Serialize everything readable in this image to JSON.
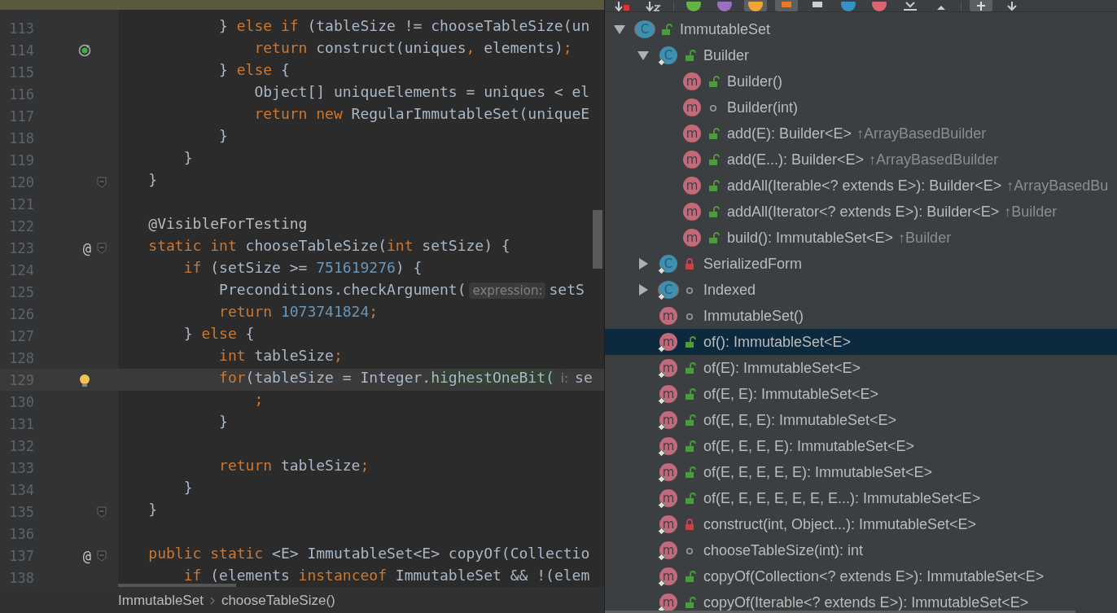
{
  "editor": {
    "lines": [
      {
        "number": "113",
        "fold": false,
        "current": false,
        "tokens": [
          {
            "kind": "plain",
            "text": "            } "
          },
          {
            "kind": "keyword",
            "text": "else if"
          },
          {
            "kind": "plain",
            "text": " (tableSize != chooseTableSize(un"
          }
        ]
      },
      {
        "number": "114",
        "gutter_icon": {
          "kind": "recursion"
        },
        "fold": false,
        "current": false,
        "tokens": [
          {
            "kind": "keyword",
            "text": "                return"
          },
          {
            "kind": "plain",
            "text": " construct(uniques"
          },
          {
            "kind": "keyword",
            "text": ","
          },
          {
            "kind": "plain",
            "text": " elements)"
          },
          {
            "kind": "keyword",
            "text": ";"
          }
        ]
      },
      {
        "number": "115",
        "fold": false,
        "current": false,
        "tokens": [
          {
            "kind": "plain",
            "text": "            } "
          },
          {
            "kind": "keyword",
            "text": "else"
          },
          {
            "kind": "plain",
            "text": " {"
          }
        ]
      },
      {
        "number": "116",
        "fold": false,
        "current": false,
        "tokens": [
          {
            "kind": "plain",
            "text": "                Object[] uniqueElements = uniques < el"
          }
        ]
      },
      {
        "number": "117",
        "fold": false,
        "current": false,
        "tokens": [
          {
            "kind": "keyword",
            "text": "                return new"
          },
          {
            "kind": "plain",
            "text": " RegularImmutableSet(uniqueE"
          }
        ]
      },
      {
        "number": "118",
        "fold": false,
        "current": false,
        "tokens": [
          {
            "kind": "plain",
            "text": "            }"
          }
        ]
      },
      {
        "number": "119",
        "fold": false,
        "current": false,
        "tokens": [
          {
            "kind": "plain",
            "text": "        }"
          }
        ]
      },
      {
        "number": "120",
        "fold": true,
        "current": false,
        "tokens": [
          {
            "kind": "plain",
            "text": "    }"
          }
        ]
      },
      {
        "number": "121",
        "fold": false,
        "current": false
      },
      {
        "number": "122",
        "fold": false,
        "current": false,
        "tokens": [
          {
            "kind": "annotation",
            "text": "    @VisibleForTesting"
          }
        ]
      },
      {
        "number": "123",
        "gutter_mark": "@",
        "fold": true,
        "current": false,
        "tokens": [
          {
            "kind": "keyword",
            "text": "    static int"
          },
          {
            "kind": "plain",
            "text": " chooseTableSize("
          },
          {
            "kind": "keyword",
            "text": "int"
          },
          {
            "kind": "plain",
            "text": " setSize) {"
          }
        ]
      },
      {
        "number": "124",
        "fold": false,
        "current": false,
        "tokens": [
          {
            "kind": "keyword",
            "text": "        if"
          },
          {
            "kind": "plain",
            "text": " (setSize >= "
          },
          {
            "kind": "number",
            "text": "751619276"
          },
          {
            "kind": "plain",
            "text": ") {"
          }
        ]
      },
      {
        "number": "125",
        "fold": false,
        "current": false,
        "tokens": [
          {
            "kind": "plain",
            "text": "            Preconditions.checkArgument("
          },
          {
            "kind": "hint",
            "text": "expression:"
          },
          {
            "kind": "plain",
            "text": "setS"
          }
        ]
      },
      {
        "number": "126",
        "fold": false,
        "current": false,
        "tokens": [
          {
            "kind": "keyword",
            "text": "            return"
          },
          {
            "kind": "number",
            "text": " 1073741824"
          },
          {
            "kind": "keyword",
            "text": ";"
          }
        ]
      },
      {
        "number": "127",
        "fold": false,
        "current": false,
        "tokens": [
          {
            "kind": "plain",
            "text": "        } "
          },
          {
            "kind": "keyword",
            "text": "else"
          },
          {
            "kind": "plain",
            "text": " {"
          }
        ]
      },
      {
        "number": "128",
        "fold": false,
        "current": false,
        "tokens": [
          {
            "kind": "keyword",
            "text": "            int"
          },
          {
            "kind": "plain",
            "text": " tableSize"
          },
          {
            "kind": "keyword",
            "text": ";"
          }
        ]
      },
      {
        "number": "129",
        "gutter_icon": {
          "kind": "bulb"
        },
        "fold": false,
        "current": true,
        "tokens": [
          {
            "kind": "keyword",
            "text": "            for"
          },
          {
            "kind": "plain",
            "text": "(tableSize = Integer."
          },
          {
            "kind": "highlight",
            "text": "highestOneBit("
          },
          {
            "kind": "hint",
            "text": "i:"
          },
          {
            "kind": "plain",
            "text": "se"
          }
        ]
      },
      {
        "number": "130",
        "fold": false,
        "current": false,
        "tokens": [
          {
            "kind": "keyword",
            "text": "                ;"
          }
        ]
      },
      {
        "number": "131",
        "fold": false,
        "current": false,
        "tokens": [
          {
            "kind": "plain",
            "text": "            }"
          }
        ]
      },
      {
        "number": "132",
        "fold": false,
        "current": false
      },
      {
        "number": "133",
        "fold": false,
        "current": false,
        "tokens": [
          {
            "kind": "keyword",
            "text": "            return"
          },
          {
            "kind": "plain",
            "text": " tableSize"
          },
          {
            "kind": "keyword",
            "text": ";"
          }
        ]
      },
      {
        "number": "134",
        "fold": false,
        "current": false,
        "tokens": [
          {
            "kind": "plain",
            "text": "        }"
          }
        ]
      },
      {
        "number": "135",
        "fold": true,
        "current": false,
        "tokens": [
          {
            "kind": "plain",
            "text": "    }"
          }
        ]
      },
      {
        "number": "136",
        "fold": false,
        "current": false
      },
      {
        "number": "137",
        "gutter_mark": "@",
        "fold": true,
        "current": false,
        "tokens": [
          {
            "kind": "keyword",
            "text": "    public static"
          },
          {
            "kind": "plain",
            "text": " <E> ImmutableSet<E> copyOf(Collectio"
          }
        ]
      },
      {
        "number": "138",
        "fold": false,
        "current": false,
        "tokens": [
          {
            "kind": "keyword",
            "text": "        if"
          },
          {
            "kind": "plain",
            "text": " (elements "
          },
          {
            "kind": "keyword",
            "text": "instanceof"
          },
          {
            "kind": "plain",
            "text": " ImmutableSet && !(elem"
          }
        ]
      }
    ],
    "breadcrumbs": [
      "ImmutableSet",
      "chooseTableSize()"
    ]
  },
  "structure": {
    "toolbar": [
      {
        "kind": "sort-visibility",
        "on": false
      },
      {
        "kind": "sort-alpha",
        "on": false
      },
      {
        "kind": "separator"
      },
      {
        "kind": "circle",
        "color": "#62b543",
        "on": false
      },
      {
        "kind": "circle",
        "color": "#9a6fc4",
        "on": false
      },
      {
        "kind": "circle",
        "color": "#f0a732",
        "on": true
      },
      {
        "kind": "square",
        "color": "#e8782c",
        "on": true
      },
      {
        "kind": "square",
        "color": "#cfcfcf",
        "on": false
      },
      {
        "kind": "circle",
        "color": "#3592c4",
        "on": false
      },
      {
        "kind": "circle",
        "color": "#d9636e",
        "on": false
      },
      {
        "kind": "expand",
        "on": false
      },
      {
        "kind": "collapse",
        "on": false
      },
      {
        "kind": "separator"
      },
      {
        "kind": "up",
        "on": true
      },
      {
        "kind": "down",
        "on": false
      }
    ],
    "tree": [
      {
        "kind": "abstract-class",
        "letter": "C",
        "access": {
          "kind": "public"
        },
        "static": false,
        "text": "ImmutableSet",
        "expanded": true,
        "selected": false,
        "children": [
          {
            "kind": "class",
            "letter": "C",
            "access": {
              "kind": "public"
            },
            "static": true,
            "text": "Builder",
            "expanded": true,
            "selected": false,
            "children": [
              {
                "kind": "method",
                "letter": "m",
                "access": {
                  "kind": "public"
                },
                "static": false,
                "text": "Builder()",
                "selected": false
              },
              {
                "kind": "method",
                "letter": "m",
                "access": {
                  "kind": "package"
                },
                "static": false,
                "text": "Builder(int)",
                "selected": false
              },
              {
                "kind": "method",
                "letter": "m",
                "access": {
                  "kind": "public"
                },
                "static": false,
                "text": "add(E): Builder<E>",
                "inherited": "↑ArrayBasedBuilder",
                "selected": false
              },
              {
                "kind": "method",
                "letter": "m",
                "access": {
                  "kind": "public"
                },
                "static": false,
                "text": "add(E...): Builder<E>",
                "inherited": "↑ArrayBasedBuilder",
                "selected": false
              },
              {
                "kind": "method",
                "letter": "m",
                "access": {
                  "kind": "public"
                },
                "static": false,
                "text": "addAll(Iterable<? extends E>): Builder<E>",
                "inherited": "↑ArrayBasedBu",
                "selected": false
              },
              {
                "kind": "method",
                "letter": "m",
                "access": {
                  "kind": "public"
                },
                "static": false,
                "text": "addAll(Iterator<? extends E>): Builder<E>",
                "inherited": "↑Builder",
                "selected": false
              },
              {
                "kind": "method",
                "letter": "m",
                "access": {
                  "kind": "public"
                },
                "static": false,
                "text": "build(): ImmutableSet<E>",
                "inherited": "↑Builder",
                "selected": false
              }
            ]
          },
          {
            "kind": "class",
            "letter": "C",
            "access": {
              "kind": "private"
            },
            "static": true,
            "text": "SerializedForm",
            "expanded": false,
            "selected": false
          },
          {
            "kind": "abstract-class",
            "letter": "C",
            "access": {
              "kind": "package"
            },
            "static": true,
            "text": "Indexed",
            "expanded": false,
            "selected": false
          },
          {
            "kind": "method",
            "letter": "m",
            "access": {
              "kind": "package"
            },
            "static": false,
            "text": "ImmutableSet()",
            "selected": false
          },
          {
            "kind": "method",
            "letter": "m",
            "access": {
              "kind": "public"
            },
            "static": true,
            "text": "of(): ImmutableSet<E>",
            "selected": true
          },
          {
            "kind": "method",
            "letter": "m",
            "access": {
              "kind": "public"
            },
            "static": true,
            "text": "of(E): ImmutableSet<E>",
            "selected": false
          },
          {
            "kind": "method",
            "letter": "m",
            "access": {
              "kind": "public"
            },
            "static": true,
            "text": "of(E, E): ImmutableSet<E>",
            "selected": false
          },
          {
            "kind": "method",
            "letter": "m",
            "access": {
              "kind": "public"
            },
            "static": true,
            "text": "of(E, E, E): ImmutableSet<E>",
            "selected": false
          },
          {
            "kind": "method",
            "letter": "m",
            "access": {
              "kind": "public"
            },
            "static": true,
            "text": "of(E, E, E, E): ImmutableSet<E>",
            "selected": false
          },
          {
            "kind": "method",
            "letter": "m",
            "access": {
              "kind": "public"
            },
            "static": true,
            "text": "of(E, E, E, E, E): ImmutableSet<E>",
            "selected": false
          },
          {
            "kind": "method",
            "letter": "m",
            "access": {
              "kind": "public"
            },
            "static": true,
            "text": "of(E, E, E, E, E, E, E...): ImmutableSet<E>",
            "selected": false
          },
          {
            "kind": "method",
            "letter": "m",
            "access": {
              "kind": "private"
            },
            "static": true,
            "text": "construct(int, Object...): ImmutableSet<E>",
            "selected": false
          },
          {
            "kind": "method",
            "letter": "m",
            "access": {
              "kind": "package"
            },
            "static": true,
            "text": "chooseTableSize(int): int",
            "selected": false
          },
          {
            "kind": "method",
            "letter": "m",
            "access": {
              "kind": "public"
            },
            "static": true,
            "text": "copyOf(Collection<? extends E>): ImmutableSet<E>",
            "selected": false
          },
          {
            "kind": "method",
            "letter": "m",
            "access": {
              "kind": "public"
            },
            "static": true,
            "text": "copyOf(Iterable<? extends E>): ImmutableSet<E>",
            "selected": false
          }
        ]
      }
    ]
  }
}
